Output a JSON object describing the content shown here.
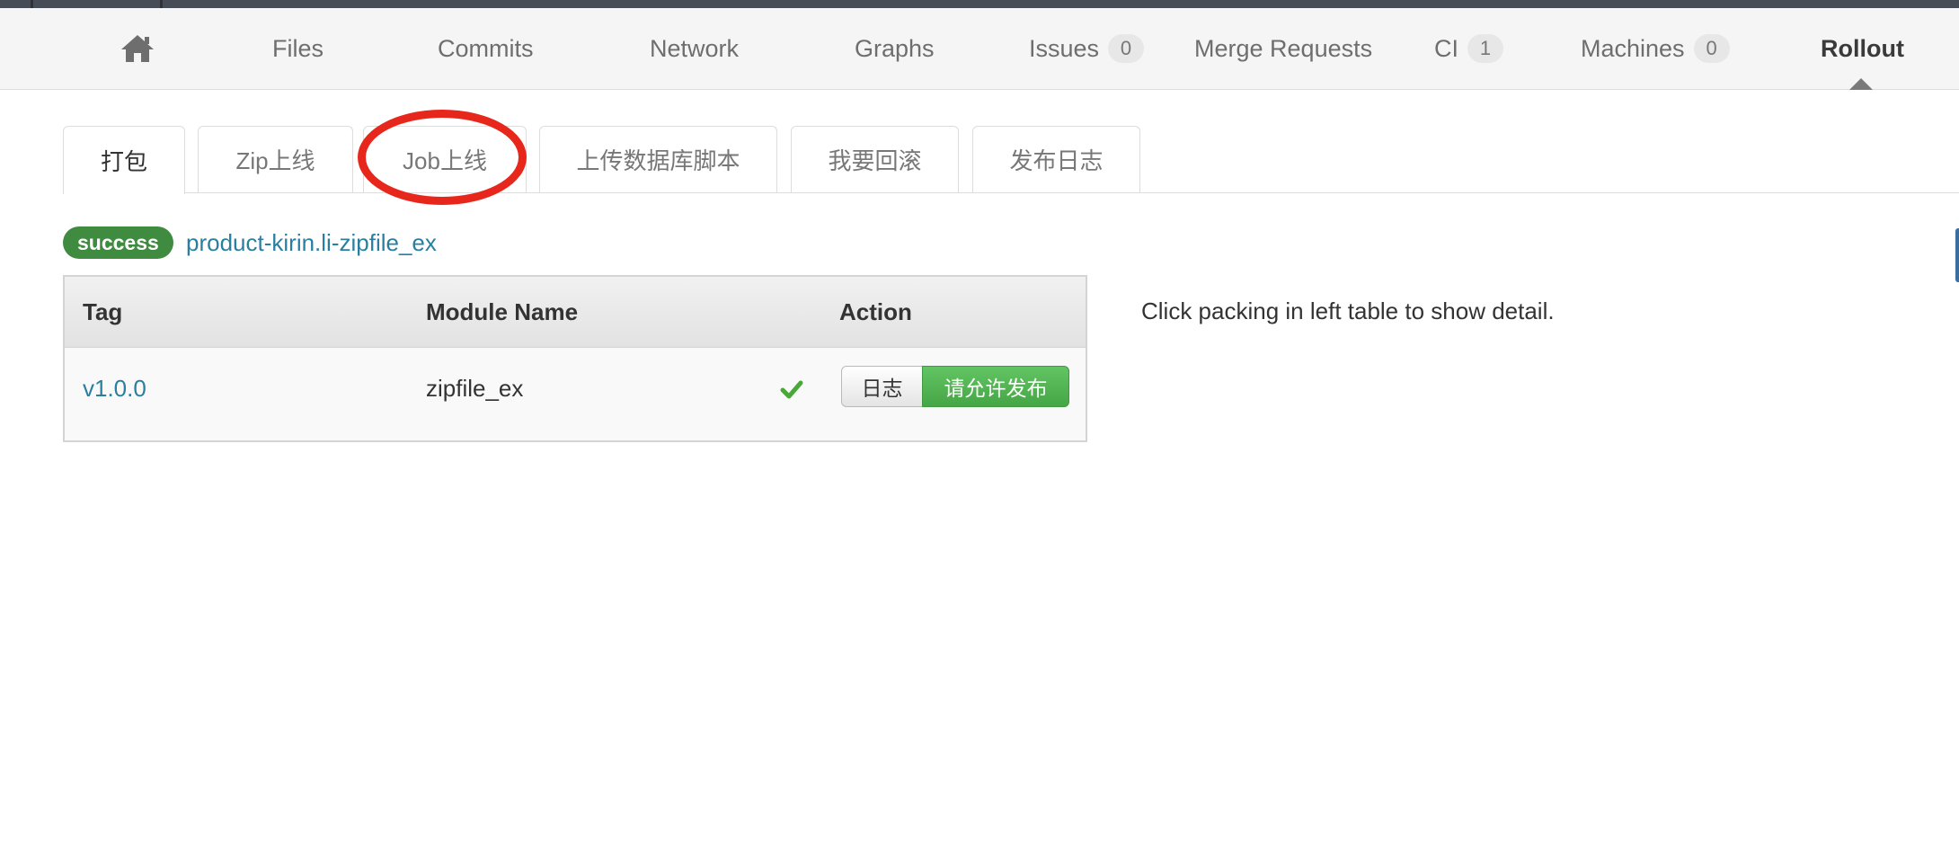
{
  "nav": {
    "home_icon": "home-icon",
    "items": [
      {
        "label": "Files"
      },
      {
        "label": "Commits"
      },
      {
        "label": "Network"
      },
      {
        "label": "Graphs"
      },
      {
        "label": "Issues",
        "badge": "0"
      },
      {
        "label": "Merge Requests"
      },
      {
        "label": "CI",
        "badge": "1"
      },
      {
        "label": "Machines",
        "badge": "0"
      },
      {
        "label": "Rollout"
      }
    ],
    "active": "Rollout"
  },
  "tabs": [
    {
      "label": "打包"
    },
    {
      "label": "Zip上线"
    },
    {
      "label": "Job上线"
    },
    {
      "label": "上传数据库脚本"
    },
    {
      "label": "我要回滚"
    },
    {
      "label": "发布日志"
    }
  ],
  "active_tab": "打包",
  "annotation_color": "#e8271c",
  "status": {
    "badge": "success",
    "badge_color": "#3f8b3f",
    "product": "product-kirin.li-zipfile_ex"
  },
  "table": {
    "headers": {
      "tag": "Tag",
      "module": "Module Name",
      "action": "Action"
    },
    "rows": [
      {
        "tag": "v1.0.0",
        "module": "zipfile_ex",
        "status_icon": "check-icon",
        "log_button": "日志",
        "publish_button": "请允许发布"
      }
    ]
  },
  "detail_hint": "Click packing in left table to show detail."
}
